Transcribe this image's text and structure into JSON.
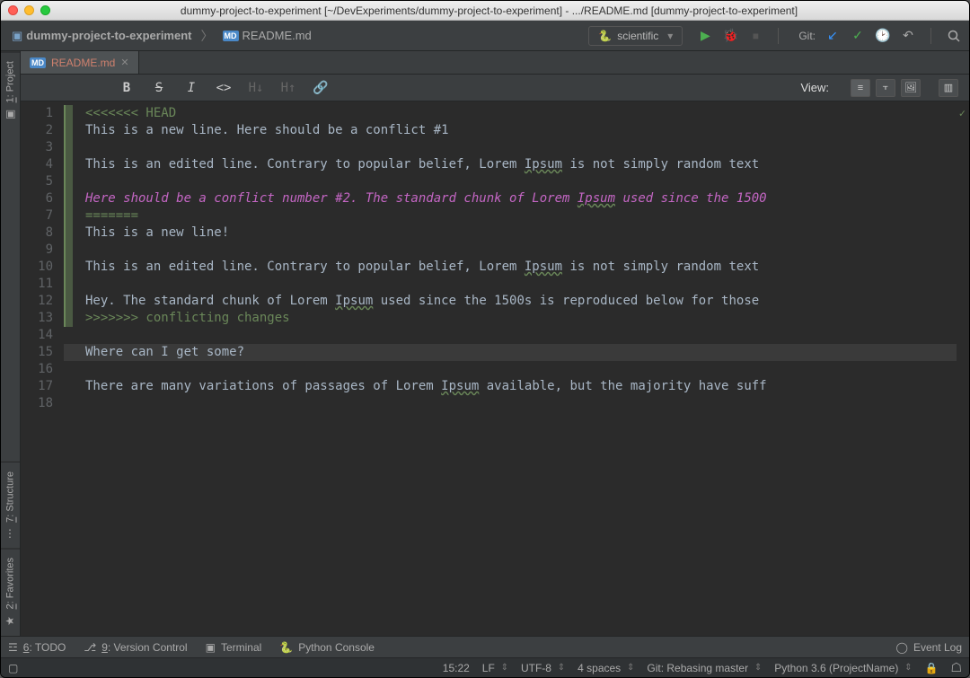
{
  "window": {
    "title": "dummy-project-to-experiment [~/DevExperiments/dummy-project-to-experiment] - .../README.md [dummy-project-to-experiment]"
  },
  "breadcrumb": {
    "project": "dummy-project-to-experiment",
    "file": "README.md"
  },
  "run_config": {
    "name": "scientific"
  },
  "nav": {
    "git_label": "Git:"
  },
  "sidebar": {
    "project": "1: Project",
    "structure": "7: Structure",
    "favorites": "2: Favorites"
  },
  "tab": {
    "filename": "README.md"
  },
  "md_toolbar": {
    "view_label": "View:"
  },
  "editor": {
    "current_line": 15,
    "lines": [
      {
        "n": 1,
        "marker": "green",
        "cls": "txt-green",
        "text": "<<<<<<< HEAD"
      },
      {
        "n": 2,
        "marker": "green",
        "cls": "txt-normal",
        "text": "This is a new line. Here should be a conflict #1"
      },
      {
        "n": 3,
        "marker": "green",
        "cls": "txt-normal",
        "text": ""
      },
      {
        "n": 4,
        "marker": "green",
        "cls": "txt-normal",
        "text": "This is an edited line. Contrary to popular belief, Lorem Ipsum is not simply random text"
      },
      {
        "n": 5,
        "marker": "green",
        "cls": "txt-normal",
        "text": ""
      },
      {
        "n": 6,
        "marker": "green",
        "cls": "txt-pink",
        "text": "Here should be a conflict number #2. The standard chunk of Lorem Ipsum used since the 1500"
      },
      {
        "n": 7,
        "marker": "green",
        "cls": "txt-green",
        "text": "======="
      },
      {
        "n": 8,
        "marker": "green",
        "cls": "txt-normal",
        "text": "This is a new line!"
      },
      {
        "n": 9,
        "marker": "green",
        "cls": "txt-normal",
        "text": ""
      },
      {
        "n": 10,
        "marker": "green",
        "cls": "txt-normal",
        "text": "This is an edited line. Contrary to popular belief, Lorem Ipsum is not simply random text"
      },
      {
        "n": 11,
        "marker": "green",
        "cls": "txt-normal",
        "text": ""
      },
      {
        "n": 12,
        "marker": "green",
        "cls": "txt-normal",
        "text": "Hey. The standard chunk of Lorem Ipsum used since the 1500s is reproduced below for those"
      },
      {
        "n": 13,
        "marker": "green",
        "cls": "txt-green",
        "text": ">>>>>>> conflicting changes"
      },
      {
        "n": 14,
        "marker": "",
        "cls": "txt-normal",
        "text": ""
      },
      {
        "n": 15,
        "marker": "",
        "cls": "txt-normal",
        "text": "Where can I get some?"
      },
      {
        "n": 16,
        "marker": "",
        "cls": "txt-normal",
        "text": ""
      },
      {
        "n": 17,
        "marker": "",
        "cls": "txt-normal",
        "text": "There are many variations of passages of Lorem Ipsum available, but the majority have suff"
      },
      {
        "n": 18,
        "marker": "",
        "cls": "txt-normal",
        "text": ""
      }
    ]
  },
  "tools": {
    "todo": "6: TODO",
    "vcs": "9: Version Control",
    "terminal": "Terminal",
    "py_console": "Python Console",
    "event_log": "Event Log"
  },
  "status": {
    "pos": "15:22",
    "line_sep": "LF",
    "encoding": "UTF-8",
    "indent": "4 spaces",
    "git": "Git: Rebasing master",
    "interpreter": "Python 3.6 (ProjectName)"
  }
}
